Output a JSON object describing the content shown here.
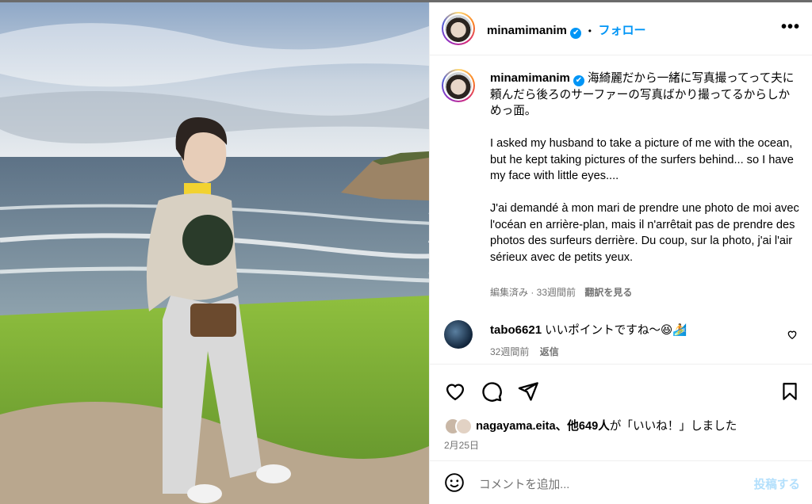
{
  "post": {
    "username": "minamimanim",
    "verified_badge": "✔",
    "separator": "•",
    "follow_label": "フォロー",
    "more_label": "•••"
  },
  "caption": {
    "username": "minamimanim",
    "jp": "海綺麗だから一緒に写真撮ってって夫に頼んだら後ろのサーファーの写真ばかり撮ってるからしかめっ面。",
    "en": "I asked my husband to take a picture of me with the ocean, but he kept taking pictures of the surfers behind... so I have my face with little eyes....",
    "fr": "J'ai demandé à mon mari de prendre une photo de moi avec l'océan en arrière-plan, mais il n'arrêtait pas de prendre des photos des surfeurs derrière. Du coup, sur la photo, j'ai l'air sérieux avec de petits yeux.",
    "meta": "編集済み · 33週間前",
    "translate": "翻訳を見る"
  },
  "comment": {
    "username": "tabo6621",
    "text": "いいポイントですね〜😆🏄",
    "time": "32週間前",
    "reply": "返信"
  },
  "likes": {
    "user": "nagayama.eita",
    "rest": "、他649人",
    "suffix": "が「いいね！」しました"
  },
  "date": "2月25日",
  "composer": {
    "placeholder": "コメントを追加...",
    "post_label": "投稿する"
  },
  "colors": {
    "accent": "#0095f6",
    "muted": "#737373",
    "post_disabled": "#b2dffc"
  },
  "icons": [
    "heart-icon",
    "comment-icon",
    "share-icon",
    "bookmark-icon",
    "emoji-icon",
    "more-icon"
  ]
}
